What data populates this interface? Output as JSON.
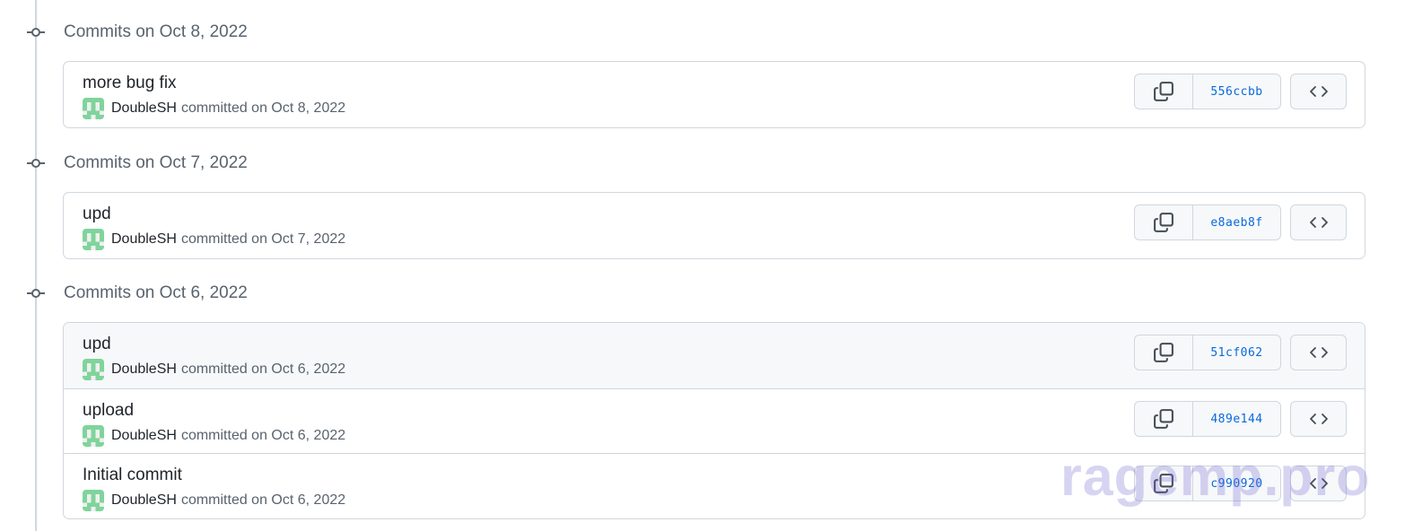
{
  "groups": [
    {
      "title": "Commits on Oct 8, 2022",
      "commits": [
        {
          "message": "more bug fix",
          "author": "DoubleSH",
          "committed": "committed on Oct 8, 2022",
          "sha": "556ccbb"
        }
      ]
    },
    {
      "title": "Commits on Oct 7, 2022",
      "commits": [
        {
          "message": "upd",
          "author": "DoubleSH",
          "committed": "committed on Oct 7, 2022",
          "sha": "e8aeb8f"
        }
      ]
    },
    {
      "title": "Commits on Oct 6, 2022",
      "commits": [
        {
          "message": "upd",
          "author": "DoubleSH",
          "committed": "committed on Oct 6, 2022",
          "sha": "51cf062"
        },
        {
          "message": "upload",
          "author": "DoubleSH",
          "committed": "committed on Oct 6, 2022",
          "sha": "489e144"
        },
        {
          "message": "Initial commit",
          "author": "DoubleSH",
          "committed": "committed on Oct 6, 2022",
          "sha": "c990920"
        }
      ]
    }
  ],
  "icons": {
    "commit": "git-commit-icon",
    "copy": "copy-icon",
    "browse": "code-icon",
    "avatar": "identicon-avatar"
  },
  "watermark": "ragemp.pro",
  "colors": {
    "link": "#0969da",
    "border": "#d0d7de",
    "avatar": "#7fd49b",
    "watermark": "#6e64d2"
  }
}
